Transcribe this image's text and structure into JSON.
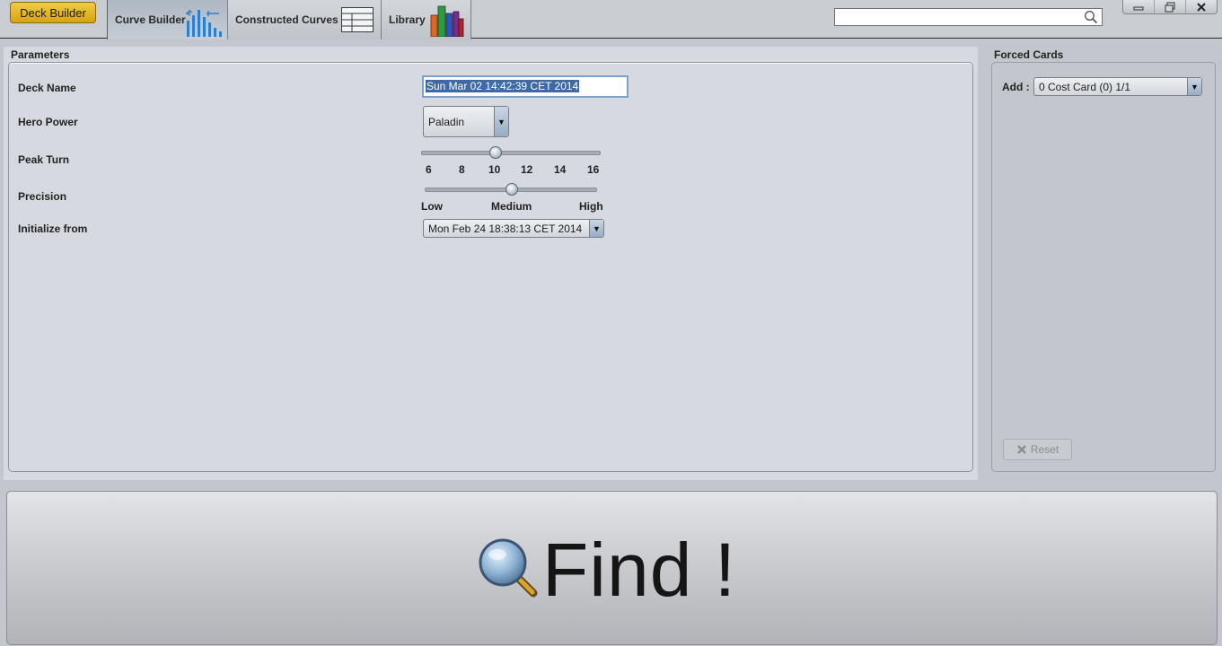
{
  "toolbar": {
    "deck_builder_label": "Deck Builder",
    "tabs": [
      {
        "label": "Curve Builder",
        "icon": "bar-chart-icon",
        "active": true
      },
      {
        "label": "Constructed Curves",
        "icon": "table-icon",
        "active": false
      },
      {
        "label": "Library",
        "icon": "books-icon",
        "active": false
      }
    ],
    "search": {
      "value": "",
      "placeholder": ""
    }
  },
  "window_controls": [
    "minimize-icon",
    "restore-icon",
    "close-icon"
  ],
  "parameters": {
    "title": "Parameters",
    "deck_name": {
      "label": "Deck Name",
      "value": "Sun Mar 02 14:42:39 CET 2014"
    },
    "hero_power": {
      "label": "Hero Power",
      "value": "Paladin"
    },
    "peak_turn": {
      "label": "Peak Turn",
      "ticks": [
        "6",
        "8",
        "10",
        "12",
        "14",
        "16"
      ],
      "value": 10,
      "min": 6,
      "max": 16
    },
    "precision": {
      "label": "Precision",
      "ticks": [
        "Low",
        "Medium",
        "High"
      ],
      "value": 0.5
    },
    "initialize_from": {
      "label": "Initialize from",
      "value": "Mon Feb 24 18:38:13 CET 2014"
    }
  },
  "forced_cards": {
    "title": "Forced Cards",
    "add_label": "Add :",
    "add_value": "0 Cost Card (0) 1/1",
    "reset_label": "Reset"
  },
  "find": {
    "label": "Find !"
  },
  "colors": {
    "accent_gold": "#e2b21f",
    "selection_blue": "#3d6aa6",
    "panel_bg": "#d6d9df"
  }
}
